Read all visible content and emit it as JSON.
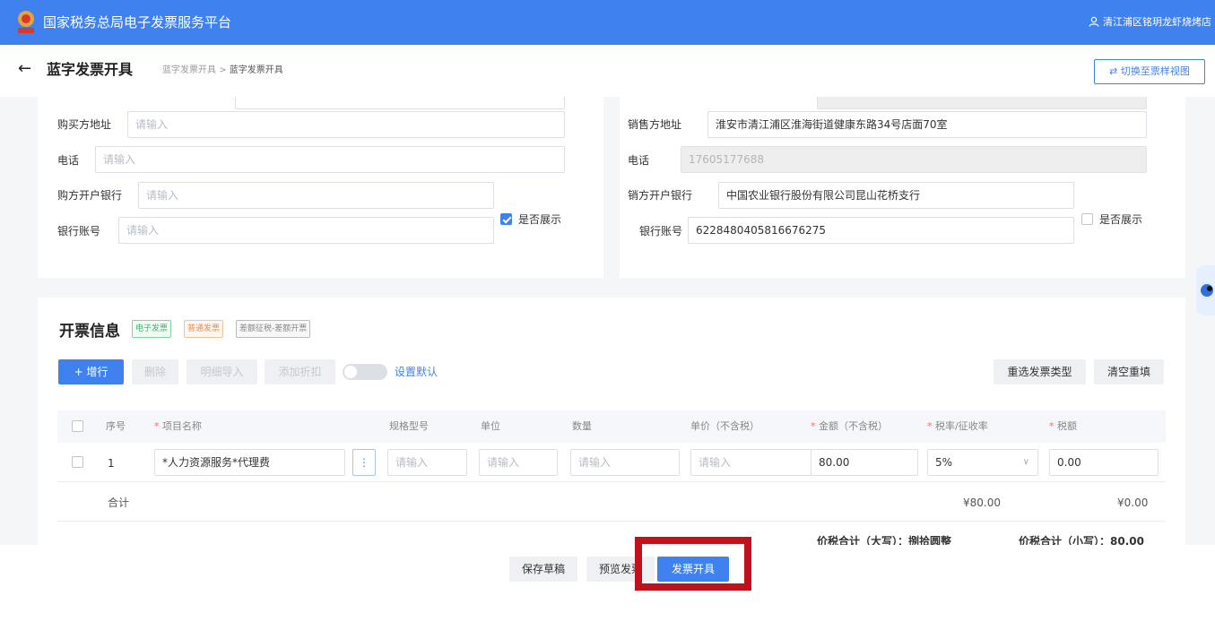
{
  "header": {
    "app_title": "国家税务总局电子发票服务平台",
    "user_name": "清江浦区铭玥龙虾烧烤店"
  },
  "pagehead": {
    "title": "蓝字发票开具",
    "breadcrumb_parent": "蓝字发票开具",
    "breadcrumb_sep": ">",
    "breadcrumb_current": "蓝字发票开具",
    "switch_label": "切换至票样视图"
  },
  "buyer": {
    "address_label": "购买方地址",
    "address_placeholder": "请输入",
    "phone_label": "电话",
    "phone_placeholder": "请输入",
    "bank_label": "购方开户银行",
    "bank_placeholder": "请输入",
    "account_label": "银行账号",
    "account_placeholder": "请输入",
    "show_label": "是否展示",
    "show_checked": true
  },
  "seller": {
    "address_label": "销售方地址",
    "address_value": "淮安市清江浦区淮海街道健康东路34号店面70室",
    "phone_label": "电话",
    "phone_value": "17605177688",
    "bank_label": "销方开户银行",
    "bank_value": "中国农业银行股份有限公司昆山花桥支行",
    "account_label": "银行账号",
    "account_value": "6228480405816676275",
    "show_label": "是否展示",
    "show_checked": false
  },
  "invoice": {
    "section_title": "开票信息",
    "tags": [
      "电子发票",
      "普通发票",
      "差额征税-差额开票"
    ],
    "toolbar": {
      "add_row": "+ 增行",
      "delete": "删除",
      "import_detail": "明细导入",
      "add_discount": "添加折扣",
      "set_default": "设置默认",
      "reselect_type": "重选发票类型",
      "clear_refill": "清空重填"
    },
    "columns": {
      "seq": "序号",
      "item_name": "项目名称",
      "spec": "规格型号",
      "unit": "单位",
      "qty": "数量",
      "price": "单价（不含税）",
      "amount": "金额（不含税）",
      "tax_rate": "税率/征收率",
      "tax": "税额"
    },
    "required_mark": "*",
    "rows": [
      {
        "seq": "1",
        "item_name": "*人力资源服务*代理费",
        "spec_placeholder": "请输入",
        "unit_placeholder": "请输入",
        "qty_placeholder": "请输入",
        "price_placeholder": "请输入",
        "amount": "80.00",
        "tax_rate": "5%",
        "tax": "0.00"
      }
    ],
    "totals": {
      "label": "合计",
      "amount": "¥80.00",
      "tax": "¥0.00"
    },
    "grand_total": {
      "upper_label": "价税合计（大写）：",
      "upper_value": "捌拾圆整",
      "lower_label": "价税合计（小写）：",
      "lower_value": "80.00"
    }
  },
  "footer": {
    "save_draft": "保存草稿",
    "preview": "预览发票",
    "issue": "发票开具"
  },
  "colors": {
    "primary": "#3f82ef",
    "highlight": "#c0111c"
  }
}
